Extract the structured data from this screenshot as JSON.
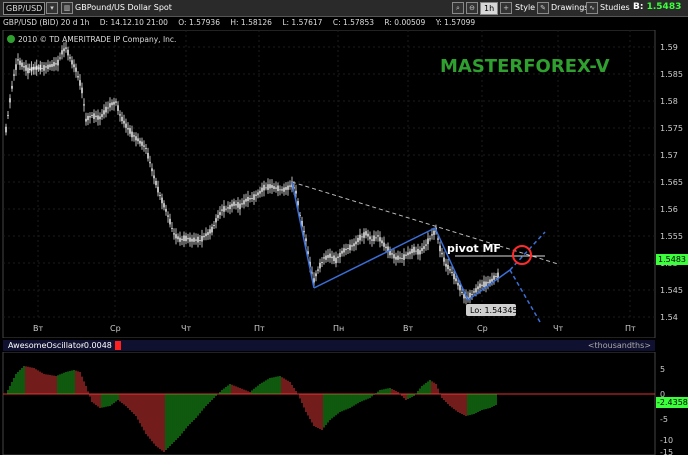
{
  "toolbar": {
    "symbol": "GBP/USD",
    "description": "GBPound/US Dollar Spot",
    "timeframe": "1h",
    "style_label": "Style",
    "drawings_label": "Drawings",
    "studies_label": "Studies",
    "bid_label": "B:",
    "bid_value": "1.5483"
  },
  "infobar": {
    "instrument": "GBP/USD (BID) 20 d 1h",
    "date": "D: 14.12.10 21:00",
    "open": "O: 1.57936",
    "high": "H: 1.58126",
    "low": "L: 1.57617",
    "close": "C: 1.57853",
    "range": "R: 0.00509",
    "y": "Y: 1.57099"
  },
  "copyright": "2010 © TD AMERITRADE IP Company, Inc.",
  "watermark": "MASTERFOREX-V",
  "annotation": "pivot MF",
  "low_label": "Lo: 1.54345",
  "price_axis": [
    "1.59",
    "1.585",
    "1.58",
    "1.575",
    "1.57",
    "1.565",
    "1.56",
    "1.555",
    "1.55",
    "1.545",
    "1.54"
  ],
  "current_price": "1.5483",
  "time_axis": [
    "Вт",
    "Ср",
    "Чт",
    "Пт",
    "Пн",
    "Вт",
    "Ср",
    "Чт",
    "Пт"
  ],
  "oscillator": {
    "name": "AwesomeOscillator",
    "value": "-0.0048",
    "last_tag": "-2.4358",
    "units": "<thousandths>",
    "axis": [
      "5",
      "0",
      "-5",
      "-10",
      "-15"
    ]
  },
  "colors": {
    "bullish": "#22c722",
    "bearish": "#ff4040",
    "watermark": "#2fa02f",
    "price_tag": "#3cff3c",
    "pivot_circle": "#ff2a2a",
    "zero_line": "#e03030"
  }
}
